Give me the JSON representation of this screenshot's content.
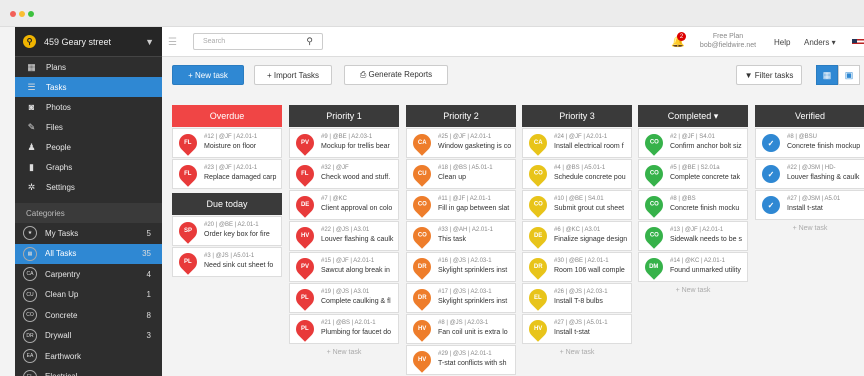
{
  "sidebar": {
    "project": "459 Geary street",
    "nav": [
      {
        "label": "Plans",
        "icon": "plans-icon",
        "glyph": "▦"
      },
      {
        "label": "Tasks",
        "icon": "tasks-icon",
        "glyph": "☰"
      },
      {
        "label": "Photos",
        "icon": "camera-icon",
        "glyph": "◙"
      },
      {
        "label": "Files",
        "icon": "paperclip-icon",
        "glyph": "✎"
      },
      {
        "label": "People",
        "icon": "people-icon",
        "glyph": "♟"
      },
      {
        "label": "Graphs",
        "icon": "bar-chart-icon",
        "glyph": "▮"
      },
      {
        "label": "Settings",
        "icon": "gear-icon",
        "glyph": "✲"
      }
    ],
    "categories_label": "Categories",
    "categories": [
      {
        "label": "My Tasks",
        "count": "5",
        "badge": "★"
      },
      {
        "label": "All Tasks",
        "count": "35",
        "badge": "▦"
      },
      {
        "label": "Carpentry",
        "count": "4",
        "badge": "CA"
      },
      {
        "label": "Clean Up",
        "count": "1",
        "badge": "CU"
      },
      {
        "label": "Concrete",
        "count": "8",
        "badge": "CO"
      },
      {
        "label": "Drywall",
        "count": "3",
        "badge": "DR"
      },
      {
        "label": "Earthwork",
        "count": "",
        "badge": "EA"
      },
      {
        "label": "Electrical",
        "count": "",
        "badge": "EL"
      }
    ]
  },
  "topbar": {
    "search_placeholder": "Search",
    "notifications": "2",
    "plan_line1": "Free Plan",
    "plan_line2": "bob@fieldwire.net",
    "help": "Help",
    "user": "Anders ▾"
  },
  "toolbar": {
    "new_task": "+ New task",
    "import": "+ Import Tasks",
    "generate": "⎙ Generate Reports",
    "filter": "▼ Filter tasks"
  },
  "colors": {
    "accent": "#2f88d3",
    "overdue": "#f04545",
    "header": "#3a3a3a"
  },
  "columns": [
    {
      "title": "Overdue",
      "style": "red",
      "cards": [
        {
          "meta": "#12 | @JF | A2.01-1",
          "title": "Moisture on floor",
          "badge": "FL",
          "color": "#e83a3a"
        },
        {
          "meta": "#23 | @JF | A2.01-1",
          "title": "Replace damaged carp",
          "badge": "FL",
          "color": "#e83a3a"
        }
      ],
      "sub_title": "Due today",
      "sub_cards": [
        {
          "meta": "#20 | @BE | A2.01-1",
          "title": "Order key box for fire",
          "badge": "SP",
          "color": "#e83a3a"
        },
        {
          "meta": "#3 | @JS | A5.01-1",
          "title": "Need sink cut sheet fo",
          "badge": "PL",
          "color": "#e83a3a"
        }
      ]
    },
    {
      "title": "Priority 1",
      "new_task": "+ New task",
      "cards": [
        {
          "meta": "#9 | @BE | A2.03-1",
          "title": "Mockup for trellis bear",
          "badge": "PV",
          "color": "#e83a3a"
        },
        {
          "meta": "#32 | @JF",
          "title": "Check wood and stuff.",
          "badge": "FL",
          "color": "#e83a3a"
        },
        {
          "meta": "#7 | @KC",
          "title": "Client approval on colo",
          "badge": "DE",
          "color": "#e83a3a"
        },
        {
          "meta": "#22 | @JS | A3.01",
          "title": "Louver flashing & caulk",
          "badge": "HV",
          "color": "#e83a3a"
        },
        {
          "meta": "#15 | @JF | A2.01-1",
          "title": "Sawcut along break in",
          "badge": "PV",
          "color": "#e83a3a"
        },
        {
          "meta": "#19 | @JS | A3.01",
          "title": "Complete caulking & fl",
          "badge": "PL",
          "color": "#e83a3a"
        },
        {
          "meta": "#21 | @BS | A2.01-1",
          "title": "Plumbing for faucet do",
          "badge": "PL",
          "color": "#e83a3a"
        }
      ]
    },
    {
      "title": "Priority 2",
      "new_task": "+ New task",
      "cards": [
        {
          "meta": "#25 | @JF | A2.01-1",
          "title": "Window gasketing is co",
          "badge": "CA",
          "color": "#ee7d2b"
        },
        {
          "meta": "#18 | @BS | A5.01-1",
          "title": "Clean up",
          "badge": "CU",
          "color": "#ee7d2b"
        },
        {
          "meta": "#11 | @JF | A2.01-1",
          "title": "Fill in gap between slat",
          "badge": "CO",
          "color": "#ee7d2b"
        },
        {
          "meta": "#33 | @AH | A2.01-1",
          "title": "This task",
          "badge": "CO",
          "color": "#ee7d2b"
        },
        {
          "meta": "#16 | @JS | A2.03-1",
          "title": "Skylight sprinklers inst",
          "badge": "DR",
          "color": "#ee7d2b"
        },
        {
          "meta": "#17 | @JS | A2.03-1",
          "title": "Skylight sprinklers inst",
          "badge": "DR",
          "color": "#ee7d2b"
        },
        {
          "meta": "#8 | @JS | A2.03-1",
          "title": "Fan coil unit is extra lo",
          "badge": "HV",
          "color": "#ee7d2b"
        },
        {
          "meta": "#29 | @JS | A2.01-1",
          "title": "T-stat conflicts with sh",
          "badge": "HV",
          "color": "#ee7d2b"
        }
      ]
    },
    {
      "title": "Priority 3",
      "new_task": "+ New task",
      "cards": [
        {
          "meta": "#24 | @JF | A2.01-1",
          "title": "Install electrical room f",
          "badge": "CA",
          "color": "#e8c41a"
        },
        {
          "meta": "#4 | @BS | A5.01-1",
          "title": "Schedule concrete pou",
          "badge": "CO",
          "color": "#e8c41a"
        },
        {
          "meta": "#10 | @BE | S4.01",
          "title": "Submit grout cut sheet",
          "badge": "CO",
          "color": "#e8c41a"
        },
        {
          "meta": "#6 | @KC | A3.01",
          "title": "Finalize signage design",
          "badge": "DE",
          "color": "#e8c41a"
        },
        {
          "meta": "#30 | @BE | A2.01-1",
          "title": "Room 106 wall comple",
          "badge": "DR",
          "color": "#e8c41a"
        },
        {
          "meta": "#26 | @JS | A2.03-1",
          "title": "Install T-8 bulbs",
          "badge": "EL",
          "color": "#e8c41a"
        },
        {
          "meta": "#27 | @JS | A5.01-1",
          "title": "Install t-stat",
          "badge": "HV",
          "color": "#e8c41a"
        }
      ]
    },
    {
      "title": "Completed  ▾",
      "new_task": "+ New task",
      "cards": [
        {
          "meta": "#2 | @JF | S4.01",
          "title": "Confirm anchor bolt siz",
          "badge": "CO",
          "color": "#36b24a"
        },
        {
          "meta": "#5 | @BE | S2.01a",
          "title": "Complete concrete tak",
          "badge": "CO",
          "color": "#36b24a"
        },
        {
          "meta": "#8 | @BS",
          "title": "Concrete finish mocku",
          "badge": "CO",
          "color": "#36b24a"
        },
        {
          "meta": "#13 | @JF | A2.01-1",
          "title": "Sidewalk needs to be s",
          "badge": "CO",
          "color": "#36b24a"
        },
        {
          "meta": "#14 | @KC | A2.01-1",
          "title": "Found unmarked utility",
          "badge": "DM",
          "color": "#36b24a"
        }
      ]
    },
    {
      "title": "Verified",
      "new_task": "+ New task",
      "cards": [
        {
          "meta": "#8 | @BSU",
          "title": "Concrete finish mockup",
          "badge": "✓",
          "color": "#2f88d3"
        },
        {
          "meta": "#22 | @JSM | HD-",
          "title": "Louver flashing & caulk",
          "badge": "✓",
          "color": "#2f88d3"
        },
        {
          "meta": "#27 | @JSM | A5.01",
          "title": "Install t-stat",
          "badge": "✓",
          "color": "#2f88d3"
        }
      ]
    }
  ]
}
